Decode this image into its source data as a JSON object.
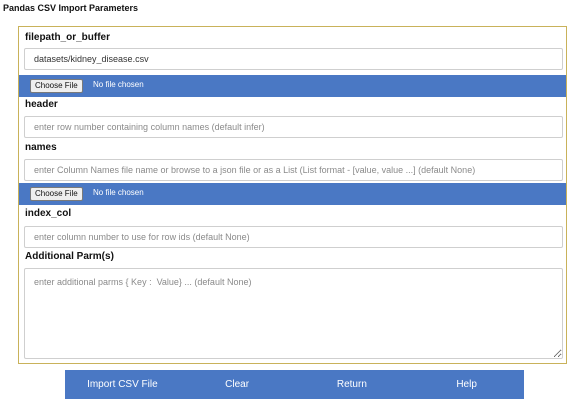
{
  "page_title": "Pandas CSV Import Parameters",
  "filepath": {
    "label": "filepath_or_buffer",
    "value": "datasets/kidney_disease.csv",
    "choose_file": "Choose File",
    "file_status": "No file chosen"
  },
  "header": {
    "label": "header",
    "placeholder": "enter row number containing column names (default infer)"
  },
  "names": {
    "label": "names",
    "placeholder": "enter Column Names file name or browse to a json file or as a List (List format - [value, value ...] (default None)",
    "choose_file": "Choose File",
    "file_status": "No file chosen"
  },
  "index_col": {
    "label": "index_col",
    "placeholder": "enter column number to use for row ids (default None)"
  },
  "additional": {
    "label": "Additional Parm(s)",
    "placeholder": "enter additional parms { Key :  Value} ... (default None)"
  },
  "actions": {
    "import": "Import CSV File",
    "clear": "Clear",
    "return": "Return",
    "help": "Help"
  },
  "colors": {
    "accent": "#4a78c4",
    "panel_border": "#c9b25a"
  }
}
